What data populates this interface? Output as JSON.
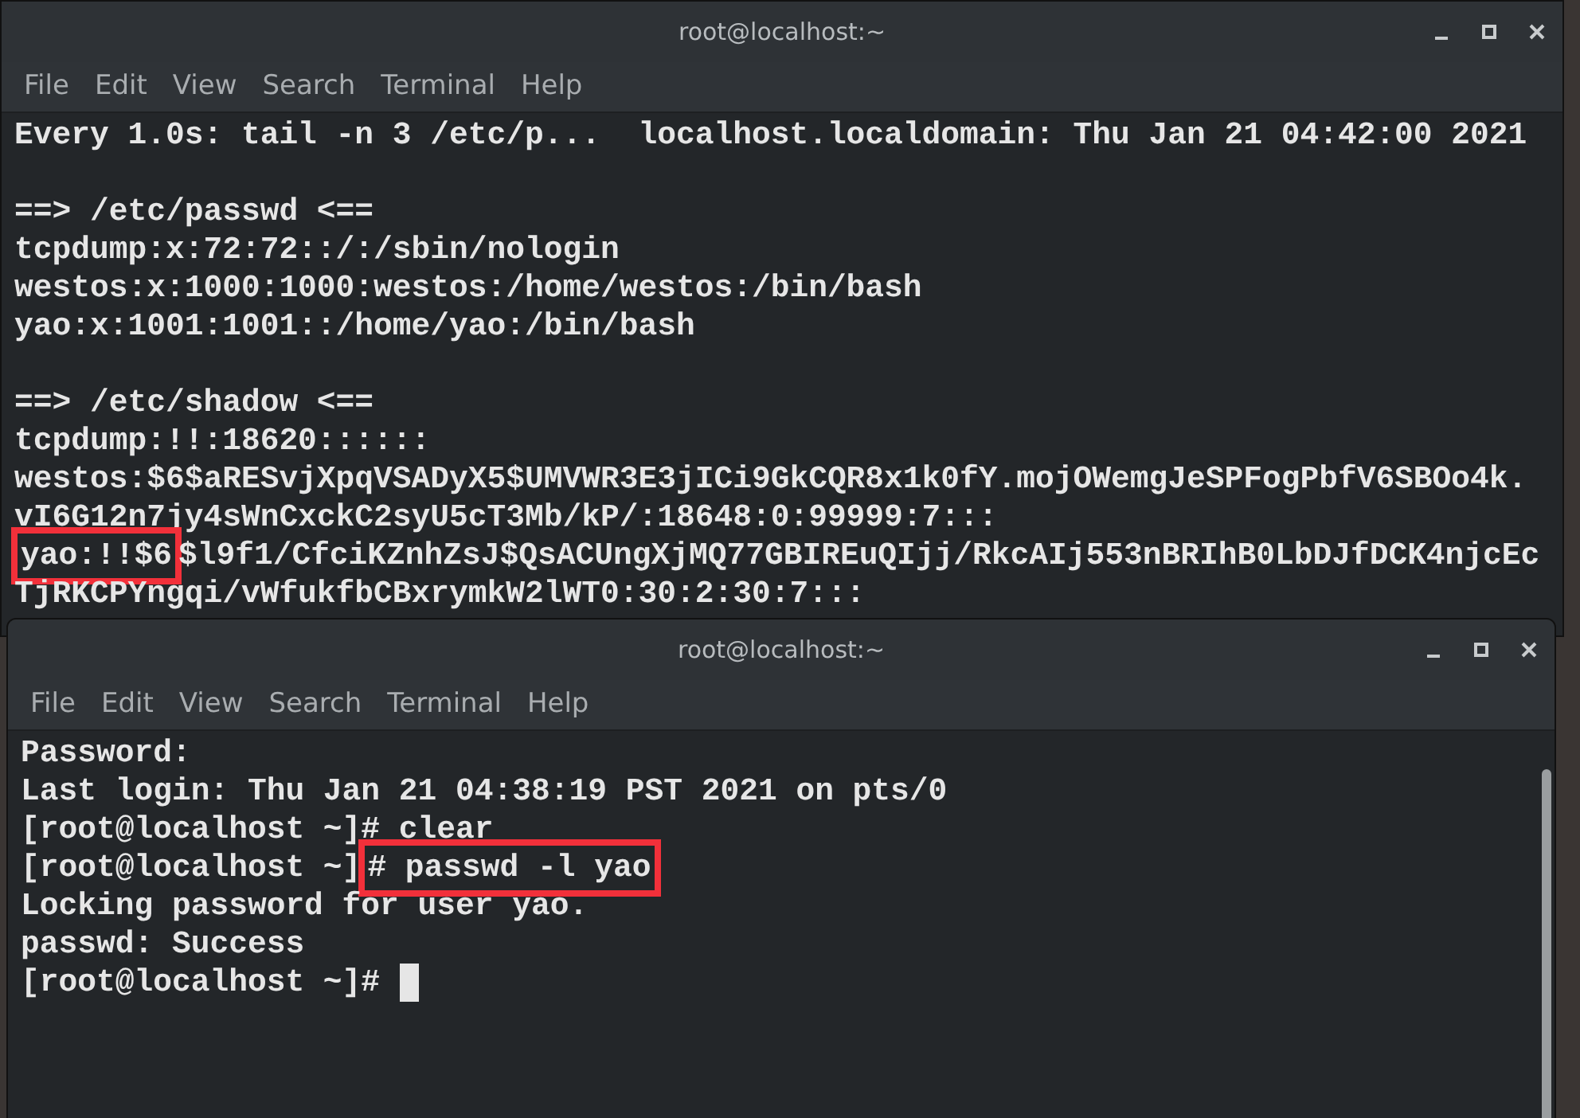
{
  "windows": [
    {
      "title": "root@localhost:~",
      "menu": [
        "File",
        "Edit",
        "View",
        "Search",
        "Terminal",
        "Help"
      ],
      "lines": [
        {
          "kind": "text",
          "segments": [
            {
              "text": "Every 1.0s: tail -n 3 /etc/p...  localhost.localdomain: Thu Jan 21 04:42:00 2021",
              "boxed": false
            }
          ]
        },
        {
          "kind": "blank"
        },
        {
          "kind": "text",
          "segments": [
            {
              "text": "==> /etc/passwd <==",
              "boxed": false
            }
          ]
        },
        {
          "kind": "text",
          "segments": [
            {
              "text": "tcpdump:x:72:72::/:/sbin/nologin",
              "boxed": false
            }
          ]
        },
        {
          "kind": "text",
          "segments": [
            {
              "text": "westos:x:1000:1000:westos:/home/westos:/bin/bash",
              "boxed": false
            }
          ]
        },
        {
          "kind": "text",
          "segments": [
            {
              "text": "yao:x:1001:1001::/home/yao:/bin/bash",
              "boxed": false
            }
          ]
        },
        {
          "kind": "blank"
        },
        {
          "kind": "text",
          "segments": [
            {
              "text": "==> /etc/shadow <==",
              "boxed": false
            }
          ]
        },
        {
          "kind": "text",
          "segments": [
            {
              "text": "tcpdump:!!:18620::::::",
              "boxed": false
            }
          ]
        },
        {
          "kind": "text",
          "segments": [
            {
              "text": "westos:$6$aRESvjXpqVSADyX5$UMVWR3E3jICi9GkCQR8x1k0fY.mojOWemgJeSPFogPbfV6SBOo4k.",
              "boxed": false
            }
          ]
        },
        {
          "kind": "text",
          "segments": [
            {
              "text": "vI6G12n7jy4sWnCxckC2syU5cT3Mb/kP/:18648:0:99999:7:::",
              "boxed": false
            }
          ]
        },
        {
          "kind": "text",
          "segments": [
            {
              "text": "yao:!!$6",
              "boxed": true
            },
            {
              "text": "$l9f1/CfciKZnhZsJ$QsACUngXjMQ77GBIREuQIjj/RkcAIj553nBRIhB0LbDJfDCK4njcEc",
              "boxed": false
            }
          ]
        },
        {
          "kind": "text",
          "segments": [
            {
              "text": "TjRKCPYngqi/vWfukfbCBxrymkW2lWT0:30:2:30:7:::",
              "boxed": false
            }
          ]
        }
      ]
    },
    {
      "title": "root@localhost:~",
      "menu": [
        "File",
        "Edit",
        "View",
        "Search",
        "Terminal",
        "Help"
      ],
      "lines": [
        {
          "kind": "text",
          "segments": [
            {
              "text": "Password:",
              "boxed": false
            }
          ]
        },
        {
          "kind": "text",
          "segments": [
            {
              "text": "Last login: Thu Jan 21 04:38:19 PST 2021 on pts/0",
              "boxed": false
            }
          ]
        },
        {
          "kind": "text",
          "segments": [
            {
              "text": "[root@localhost ~]# clear",
              "boxed": false
            }
          ]
        },
        {
          "kind": "text",
          "segments": [
            {
              "text": "[root@localhost ~]",
              "boxed": false
            },
            {
              "text": "# passwd -l yao",
              "boxed": true
            }
          ]
        },
        {
          "kind": "text",
          "segments": [
            {
              "text": "Locking password for user yao.",
              "boxed": false
            }
          ]
        },
        {
          "kind": "text",
          "segments": [
            {
              "text": "passwd: Success",
              "boxed": false
            }
          ]
        },
        {
          "kind": "text",
          "segments": [
            {
              "text": "[root@localhost ~]#",
              "boxed": false
            }
          ]
        }
      ],
      "cursor": true
    }
  ]
}
